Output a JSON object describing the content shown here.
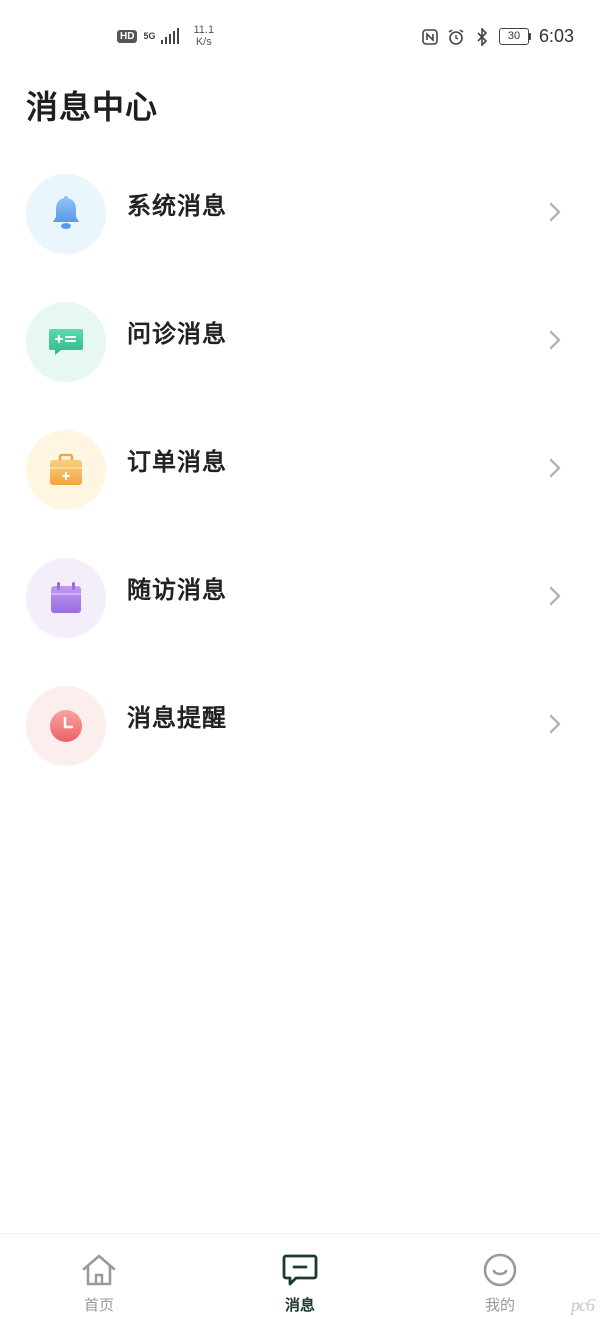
{
  "status_bar": {
    "hd": "HD",
    "network": "5G",
    "speed_value": "11.1",
    "speed_unit": "K/s",
    "battery": "30",
    "time": "6:03"
  },
  "page": {
    "title": "消息中心"
  },
  "messages": [
    {
      "label": "系统消息",
      "icon": "bell-icon",
      "bg": "#e9f6fb",
      "color": "#6aa7ec"
    },
    {
      "label": "问诊消息",
      "icon": "chat-icon",
      "bg": "#e6f8f1",
      "color": "#3fc79a"
    },
    {
      "label": "订单消息",
      "icon": "order-box-icon",
      "bg": "#fff6e2",
      "color": "#f3b558"
    },
    {
      "label": "随访消息",
      "icon": "calendar-icon",
      "bg": "#f4eefb",
      "color": "#a47be6"
    },
    {
      "label": "消息提醒",
      "icon": "clock-icon",
      "bg": "#fdeeee",
      "color": "#f07a7a"
    }
  ],
  "tabs": [
    {
      "label": "首页",
      "icon": "home-icon",
      "active": false
    },
    {
      "label": "消息",
      "icon": "message-icon",
      "active": true
    },
    {
      "label": "我的",
      "icon": "smile-icon",
      "active": false
    }
  ],
  "watermark": "pc6",
  "colors": {
    "active_tab": "#1b3a34",
    "inactive_tab": "#9a9a9a",
    "chevron": "#b5b5b5"
  }
}
